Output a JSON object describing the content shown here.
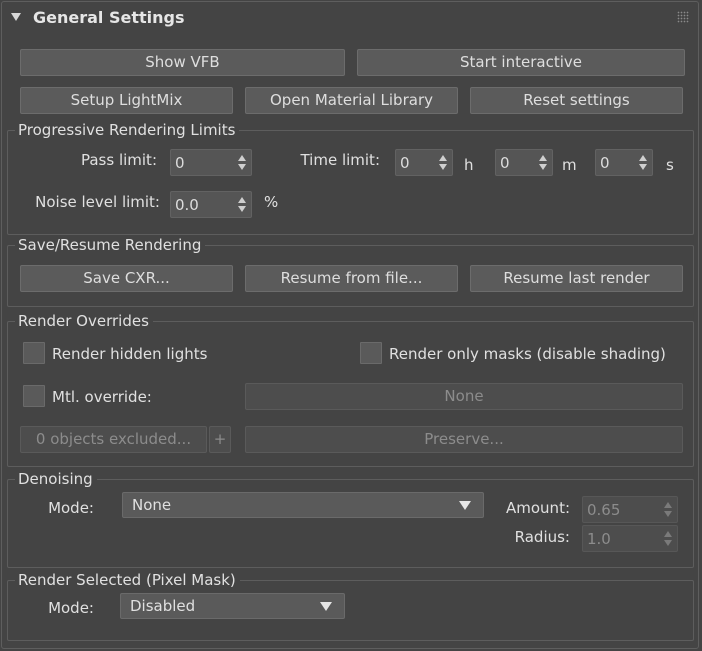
{
  "rollout": {
    "title": "General Settings"
  },
  "buttons": {
    "show_vfb": "Show VFB",
    "start_interactive": "Start interactive",
    "setup_lightmix": "Setup LightMix",
    "open_material_library": "Open Material Library",
    "reset_settings": "Reset settings"
  },
  "progressive": {
    "title": "Progressive Rendering Limits",
    "pass_limit_label": "Pass limit:",
    "pass_limit_value": "0",
    "time_limit_label": "Time limit:",
    "hours_value": "0",
    "hours_unit": "h",
    "minutes_value": "0",
    "minutes_unit": "m",
    "seconds_value": "0",
    "seconds_unit": "s",
    "noise_label": "Noise level limit:",
    "noise_value": "0.0",
    "noise_unit": "%"
  },
  "save_resume": {
    "title": "Save/Resume Rendering",
    "save_cxr": "Save CXR...",
    "resume_from_file": "Resume from file...",
    "resume_last_render": "Resume last render"
  },
  "overrides": {
    "title": "Render Overrides",
    "render_hidden_lights": "Render hidden lights",
    "render_only_masks": "Render only masks (disable shading)",
    "mtl_override": "Mtl. override:",
    "mtl_value": "None",
    "objects_excluded": "0 objects excluded...",
    "add_symbol": "+",
    "preserve": "Preserve..."
  },
  "denoising": {
    "title": "Denoising",
    "mode_label": "Mode:",
    "mode_value": "None",
    "amount_label": "Amount:",
    "amount_value": "0.65",
    "radius_label": "Radius:",
    "radius_value": "1.0"
  },
  "render_selected": {
    "title": "Render Selected (Pixel Mask)",
    "mode_label": "Mode:",
    "mode_value": "Disabled"
  },
  "colors": {
    "background": "#444444",
    "control": "#5b5b5b",
    "text": "#dcdcdc"
  }
}
